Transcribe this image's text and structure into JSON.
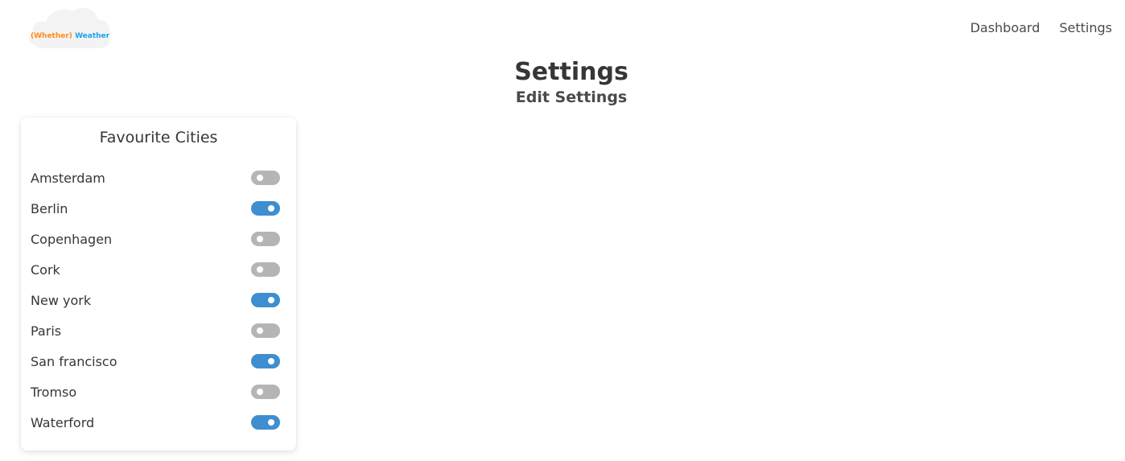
{
  "logo": {
    "part1": "(Whether)",
    "part2": "Weather"
  },
  "nav": {
    "dashboard": "Dashboard",
    "settings": "Settings"
  },
  "page": {
    "title": "Settings",
    "subtitle": "Edit Settings"
  },
  "favourites": {
    "title": "Favourite Cities",
    "cities": [
      {
        "name": "Amsterdam",
        "enabled": false
      },
      {
        "name": "Berlin",
        "enabled": true
      },
      {
        "name": "Copenhagen",
        "enabled": false
      },
      {
        "name": "Cork",
        "enabled": false
      },
      {
        "name": "New york",
        "enabled": true
      },
      {
        "name": "Paris",
        "enabled": false
      },
      {
        "name": "San francisco",
        "enabled": true
      },
      {
        "name": "Tromso",
        "enabled": false
      },
      {
        "name": "Waterford",
        "enabled": true
      }
    ]
  },
  "colors": {
    "toggle_on": "#3e8ed0",
    "toggle_off": "#b5b5b5",
    "logo_orange": "#ff8c1a",
    "logo_blue": "#1aa3e8"
  }
}
